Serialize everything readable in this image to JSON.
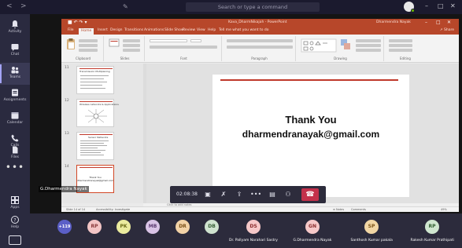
{
  "titlebar": {
    "back": "<",
    "forward": ">",
    "compose": "✎",
    "search_placeholder": "Search or type a command",
    "window_controls": [
      "–",
      "□",
      "✕"
    ]
  },
  "rail": {
    "items": [
      {
        "label": "Activity",
        "icon": "bell-icon"
      },
      {
        "label": "Chat",
        "icon": "chat-icon"
      },
      {
        "label": "Teams",
        "icon": "teams-icon",
        "active": true
      },
      {
        "label": "Assignments",
        "icon": "assignments-icon"
      },
      {
        "label": "Calendar",
        "icon": "calendar-icon"
      },
      {
        "label": "Calls",
        "icon": "phone-icon"
      },
      {
        "label": "Files",
        "icon": "file-icon"
      }
    ],
    "more": "•••",
    "bottom": [
      {
        "label": "Apps",
        "icon": "apps-icon"
      },
      {
        "label": "Help",
        "icon": "help-icon"
      }
    ]
  },
  "powerpoint": {
    "quick_access": "■ ↶ ↷ ▾",
    "document_title": "Kava_DharmNikajah - PowerPoint",
    "user_name": "Dharmendra Nayak",
    "window_controls": [
      "–",
      "□",
      "✕"
    ],
    "tabs": [
      "File",
      "Home",
      "Insert",
      "Design",
      "Transitions",
      "Animations",
      "Slide Show",
      "Review",
      "View",
      "Help",
      "Tell me what you want to do"
    ],
    "active_tab": "Home",
    "share_label": "↗ Share",
    "ribbon_groups": [
      "Clipboard",
      "Slides",
      "Font",
      "Paragraph",
      "Drawing",
      "Editing"
    ],
    "thumbnails": [
      {
        "number": "11",
        "title": "Transmission Multiplexing",
        "lines": 6
      },
      {
        "number": "12",
        "title": "Wireless networks & Applications",
        "lines": 5
      },
      {
        "number": "13",
        "title": "Sensor Networks",
        "lines": 7
      },
      {
        "number": "14",
        "title": "",
        "lines": 0,
        "center_text": [
          "Thank You",
          "dharmendranayak@gmail.com"
        ],
        "selected": true
      }
    ],
    "slide": {
      "heading": "Thank You",
      "email": "dharmendranayak@gmail.com"
    },
    "notes_placeholder": "Click to add notes",
    "status_left": "Slide 14 of 14",
    "status_lang": "Accessibility: Investigate",
    "status_notes": "≡ Notes",
    "status_comments": "Comments",
    "status_zoom": "49%"
  },
  "presenter_name": "G.Dharmendra Nayak",
  "call": {
    "timer": "02:08:38",
    "buttons": [
      {
        "name": "camera-off-icon",
        "glyph": "▣"
      },
      {
        "name": "mic-off-icon",
        "glyph": "✗"
      },
      {
        "name": "share-screen-icon",
        "glyph": "⇪"
      },
      {
        "name": "more-actions-icon",
        "glyph": "•••"
      },
      {
        "name": "chat-toggle-icon",
        "glyph": "▤"
      },
      {
        "name": "participants-icon",
        "glyph": "⚇"
      }
    ],
    "hangup_glyph": "☎"
  },
  "participants": [
    {
      "initials": "+119",
      "color": "#5b5fc7",
      "text_color": "#ffffff",
      "name": ""
    },
    {
      "initials": "RP",
      "color": "#f3c5c5",
      "text_color": "#8a3b3b",
      "name": ""
    },
    {
      "initials": "PK",
      "color": "#ebeb9e",
      "text_color": "#6a6a14",
      "name": ""
    },
    {
      "initials": "MB",
      "color": "#d9c3e6",
      "text_color": "#5b3a70",
      "name": ""
    },
    {
      "initials": "DR",
      "color": "#f2d2a6",
      "text_color": "#7a4f15",
      "name": ""
    },
    {
      "initials": "DB",
      "color": "#cfe3cf",
      "text_color": "#355d35",
      "name": ""
    },
    {
      "initials": "DS",
      "color": "#f6c8c8",
      "text_color": "#8a2c2c",
      "name": "Dr. Pallyam Narahari Sastry"
    },
    {
      "initials": "GN",
      "color": "#f6c8c8",
      "text_color": "#8a2c2c",
      "name": "G.Dharmendra Nayak"
    },
    {
      "initials": "SP",
      "color": "#f2d6a4",
      "text_color": "#7a5115",
      "name": "Santhosh Kumar pakala"
    },
    {
      "initials": "RP",
      "color": "#cfe6cf",
      "text_color": "#2f5d2f",
      "name": "Rakesh Kumar Prathipati"
    }
  ]
}
